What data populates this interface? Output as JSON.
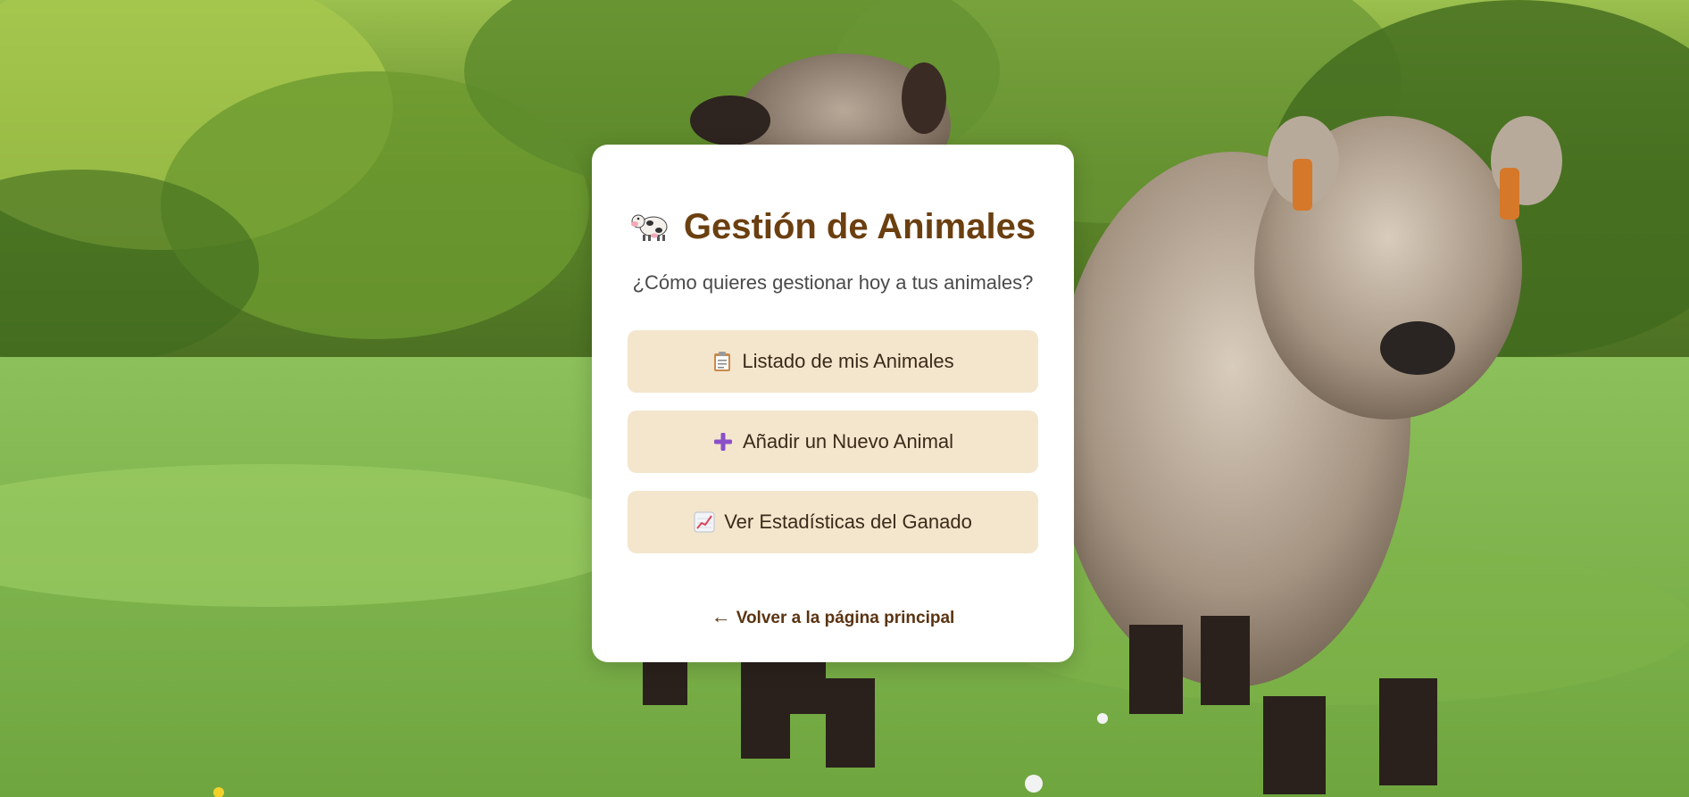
{
  "background": {
    "description_icon": "highland-calves-photo",
    "grass_color": "#86b84e",
    "foliage_color": "#4f7a22"
  },
  "card": {
    "title_icon": "cow-icon",
    "title": "Gestión de Animales",
    "subtitle": "¿Cómo quieres gestionar hoy a tus animales?",
    "buttons": [
      {
        "icon": "clipboard-icon",
        "label": "Listado de mis Animales"
      },
      {
        "icon": "plus-icon",
        "label": "Añadir un Nuevo Animal"
      },
      {
        "icon": "chart-increasing-icon",
        "label": "Ver Estadísticas del Ganado"
      }
    ],
    "back_arrow": "←",
    "back_label": "Volver a la página principal"
  },
  "colors": {
    "title": "#6b3f10",
    "button_bg": "#f3e6cc",
    "plus_icon": "#8a4fc9"
  }
}
